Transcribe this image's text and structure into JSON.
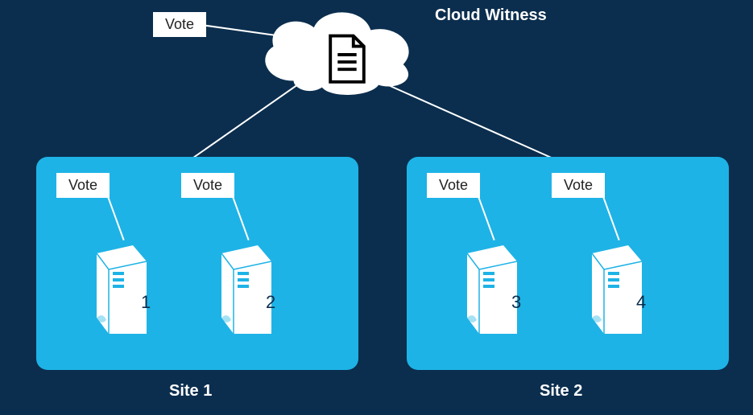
{
  "diagram": {
    "title": "Cloud Witness",
    "cloud": {
      "vote": "Vote"
    },
    "sites": [
      {
        "label": "Site 1",
        "servers": [
          {
            "num": "1",
            "vote": "Vote"
          },
          {
            "num": "2",
            "vote": "Vote"
          }
        ]
      },
      {
        "label": "Site 2",
        "servers": [
          {
            "num": "3",
            "vote": "Vote"
          },
          {
            "num": "4",
            "vote": "Vote"
          }
        ]
      }
    ]
  }
}
